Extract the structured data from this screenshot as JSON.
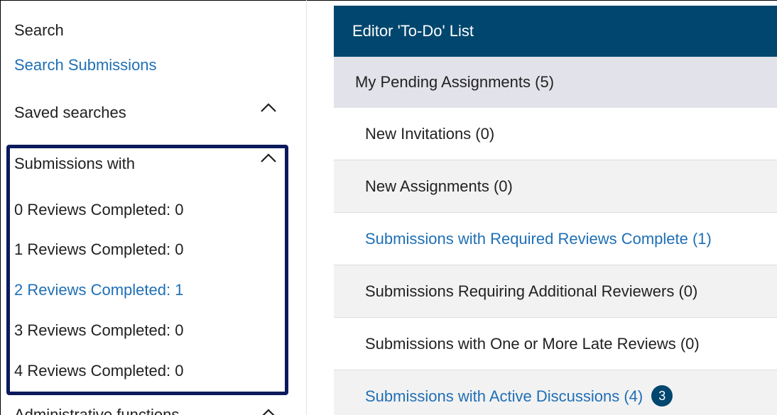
{
  "sidebar": {
    "search_heading": "Search",
    "search_link": "Search Submissions",
    "saved_searches": "Saved searches",
    "submissions_with": "Submissions with",
    "review_items": [
      {
        "label": "0 Reviews Completed: 0",
        "link": false
      },
      {
        "label": "1 Reviews Completed: 0",
        "link": false
      },
      {
        "label": "2 Reviews Completed: 1",
        "link": true
      },
      {
        "label": "3 Reviews Completed: 0",
        "link": false
      },
      {
        "label": "4 Reviews Completed: 0",
        "link": false
      }
    ],
    "admin_functions": "Administrative functions"
  },
  "todo": {
    "header": "Editor 'To-Do' List",
    "pending": "My Pending Assignments (5)",
    "rows": [
      {
        "label": "New Invitations (0)",
        "link": false
      },
      {
        "label": "New Assignments (0)",
        "link": false
      },
      {
        "label": "Submissions with Required Reviews Complete (1)",
        "link": true
      },
      {
        "label": "Submissions Requiring Additional Reviewers (0)",
        "link": false
      },
      {
        "label": "Submissions with One or More Late Reviews (0)",
        "link": false
      },
      {
        "label": "Submissions with Active Discussions (4)",
        "link": true
      }
    ],
    "discussion_badge": "3"
  },
  "colors": {
    "link": "#1f6fb5",
    "header_bg": "#00466e",
    "highlight_border": "#0b1a5c",
    "pending_bg": "#e2e2ea",
    "row_alt_bg": "#f2f2f2"
  },
  "icons": [
    "chevron-up-icon"
  ]
}
